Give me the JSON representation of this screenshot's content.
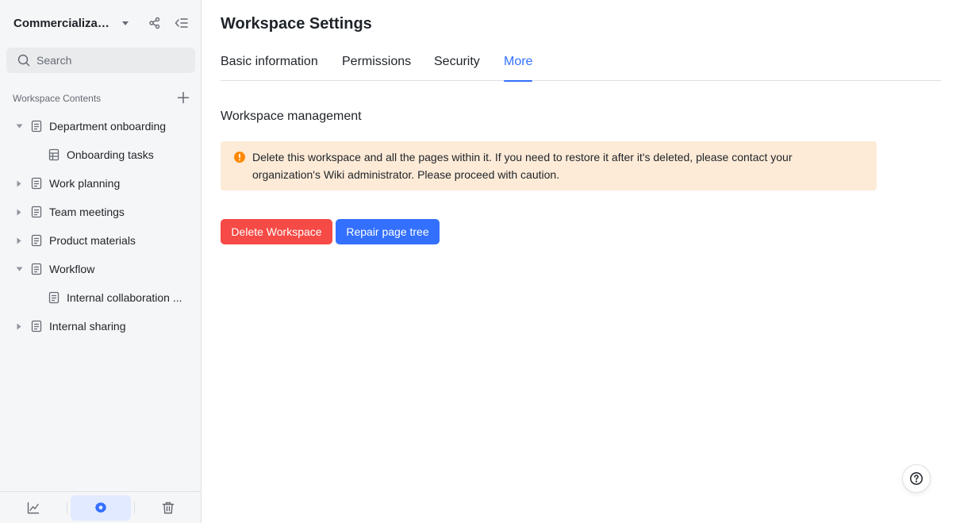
{
  "sidebar": {
    "workspace_title": "Commercializati...",
    "search_placeholder": "Search",
    "contents_label": "Workspace Contents",
    "tree": [
      {
        "label": "Department onboarding",
        "expanded": true,
        "level": 0
      },
      {
        "label": "Onboarding tasks",
        "level": 1
      },
      {
        "label": "Work planning",
        "expanded": false,
        "level": 0
      },
      {
        "label": "Team meetings",
        "expanded": false,
        "level": 0
      },
      {
        "label": "Product materials",
        "expanded": false,
        "level": 0
      },
      {
        "label": "Workflow",
        "expanded": true,
        "level": 0
      },
      {
        "label": "Internal collaboration ...",
        "level": 1
      },
      {
        "label": "Internal sharing",
        "expanded": false,
        "level": 0
      }
    ],
    "bottom_icons": [
      "analytics-icon",
      "settings-icon",
      "trash-icon"
    ],
    "active_bottom": "settings-icon"
  },
  "main": {
    "title": "Workspace Settings",
    "tabs": [
      {
        "label": "Basic information"
      },
      {
        "label": "Permissions"
      },
      {
        "label": "Security"
      },
      {
        "label": "More",
        "active": true
      }
    ],
    "section_title": "Workspace management",
    "warning_text": "Delete this workspace and all the pages within it. If you need to restore it after it's deleted, please contact your organization's Wiki administrator. Please proceed with caution.",
    "delete_button": "Delete Workspace",
    "repair_button": "Repair page tree"
  },
  "colors": {
    "accent": "#3370ff",
    "danger": "#f54a45",
    "warning_bg": "#fdebd7",
    "warning_icon": "#ff8800",
    "sidebar_bg": "#f5f6f7"
  }
}
